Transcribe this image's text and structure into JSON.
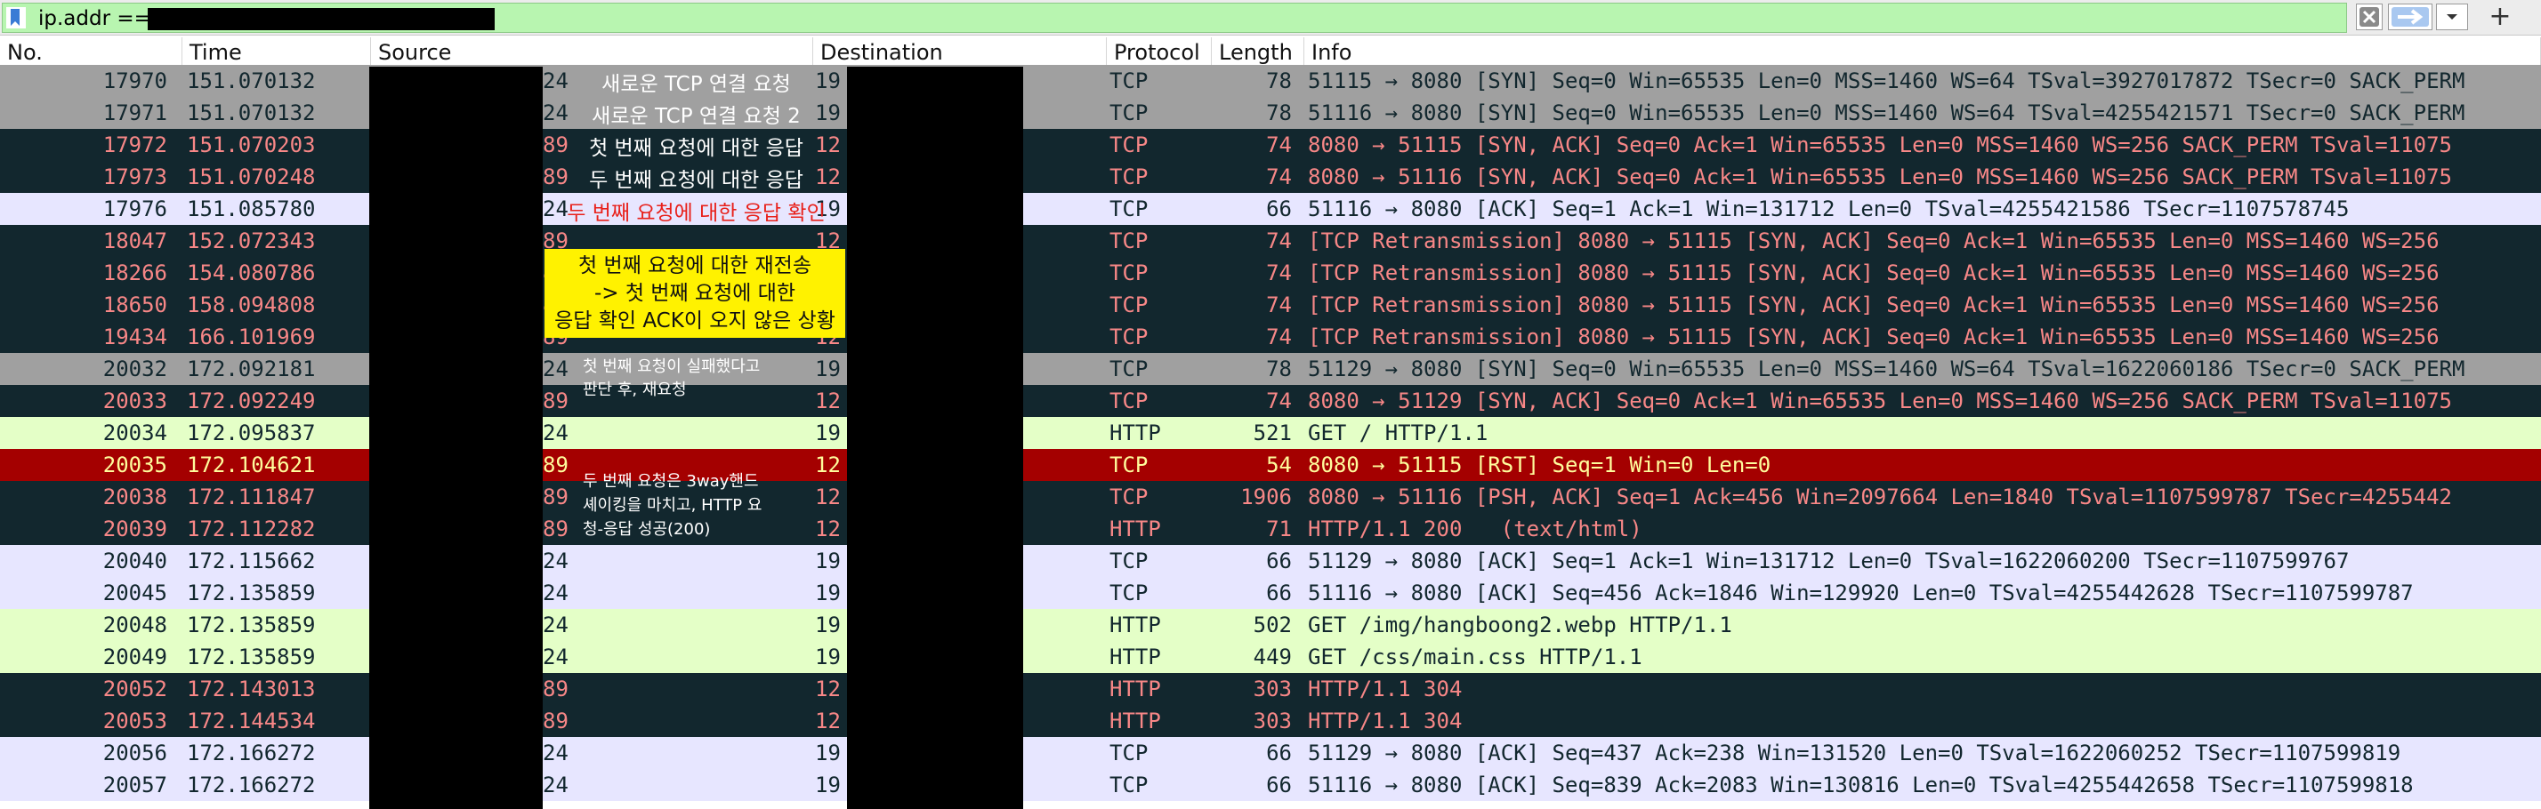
{
  "filter": {
    "value": "ip.addr ==",
    "add_label": "+"
  },
  "columns": [
    "No.",
    "Time",
    "Source",
    "Destination",
    "Protocol",
    "Length",
    "Info"
  ],
  "colors": {
    "gray_bg": "#a0a0a0",
    "gray_fg": "#12272e",
    "dark_bg": "#12272e",
    "dark_fg": "#f78787",
    "lav_bg": "#e7e6ff",
    "lav_fg": "#12272e",
    "green_bg": "#e4ffc7",
    "green_fg": "#12272e",
    "red_bg": "#a40000",
    "red_fg": "#fffc9c",
    "yellow_note": "#fff200"
  },
  "rows": [
    {
      "no": "17970",
      "time": "151.070132",
      "src": "24",
      "dst": "19",
      "proto": "TCP",
      "len": "78",
      "info": "51115 → 8080 [SYN] Seq=0 Win=65535 Len=0 MSS=1460 WS=64 TSval=3927017872 TSecr=0 SACK_PERM",
      "style": "gray"
    },
    {
      "no": "17971",
      "time": "151.070132",
      "src": "24",
      "dst": "19",
      "proto": "TCP",
      "len": "78",
      "info": "51116 → 8080 [SYN] Seq=0 Win=65535 Len=0 MSS=1460 WS=64 TSval=4255421571 TSecr=0 SACK_PERM",
      "style": "gray"
    },
    {
      "no": "17972",
      "time": "151.070203",
      "src": "89",
      "dst": "12",
      "proto": "TCP",
      "len": "74",
      "info": "8080 → 51115 [SYN, ACK] Seq=0 Ack=1 Win=65535 Len=0 MSS=1460 WS=256 SACK_PERM TSval=11075",
      "style": "dark"
    },
    {
      "no": "17973",
      "time": "151.070248",
      "src": "89",
      "dst": "12",
      "proto": "TCP",
      "len": "74",
      "info": "8080 → 51116 [SYN, ACK] Seq=0 Ack=1 Win=65535 Len=0 MSS=1460 WS=256 SACK_PERM TSval=11075",
      "style": "dark"
    },
    {
      "no": "17976",
      "time": "151.085780",
      "src": "24",
      "dst": "19",
      "proto": "TCP",
      "len": "66",
      "info": "51116 → 8080 [ACK] Seq=1 Ack=1 Win=131712 Len=0 TSval=4255421586 TSecr=1107578745",
      "style": "lav"
    },
    {
      "no": "18047",
      "time": "152.072343",
      "src": "89",
      "dst": "12",
      "proto": "TCP",
      "len": "74",
      "info": "[TCP Retransmission] 8080 → 51115 [SYN, ACK] Seq=0 Ack=1 Win=65535 Len=0 MSS=1460 WS=256",
      "style": "dark"
    },
    {
      "no": "18266",
      "time": "154.080786",
      "src": "89",
      "dst": "12",
      "proto": "TCP",
      "len": "74",
      "info": "[TCP Retransmission] 8080 → 51115 [SYN, ACK] Seq=0 Ack=1 Win=65535 Len=0 MSS=1460 WS=256",
      "style": "dark"
    },
    {
      "no": "18650",
      "time": "158.094808",
      "src": "89",
      "dst": "12",
      "proto": "TCP",
      "len": "74",
      "info": "[TCP Retransmission] 8080 → 51115 [SYN, ACK] Seq=0 Ack=1 Win=65535 Len=0 MSS=1460 WS=256",
      "style": "dark"
    },
    {
      "no": "19434",
      "time": "166.101969",
      "src": "89",
      "dst": "12",
      "proto": "TCP",
      "len": "74",
      "info": "[TCP Retransmission] 8080 → 51115 [SYN, ACK] Seq=0 Ack=1 Win=65535 Len=0 MSS=1460 WS=256",
      "style": "dark"
    },
    {
      "no": "20032",
      "time": "172.092181",
      "src": "24",
      "dst": "19",
      "proto": "TCP",
      "len": "78",
      "info": "51129 → 8080 [SYN] Seq=0 Win=65535 Len=0 MSS=1460 WS=64 TSval=1622060186 TSecr=0 SACK_PERM",
      "style": "gray"
    },
    {
      "no": "20033",
      "time": "172.092249",
      "src": "89",
      "dst": "12",
      "proto": "TCP",
      "len": "74",
      "info": "8080 → 51129 [SYN, ACK] Seq=0 Ack=1 Win=65535 Len=0 MSS=1460 WS=256 SACK_PERM TSval=11075",
      "style": "dark"
    },
    {
      "no": "20034",
      "time": "172.095837",
      "src": "24",
      "dst": "19",
      "proto": "HTTP",
      "len": "521",
      "info": "GET / HTTP/1.1",
      "style": "green"
    },
    {
      "no": "20035",
      "time": "172.104621",
      "src": "89",
      "dst": "12",
      "proto": "TCP",
      "len": "54",
      "info": "8080 → 51115 [RST] Seq=1 Win=0 Len=0",
      "style": "red"
    },
    {
      "no": "20038",
      "time": "172.111847",
      "src": "89",
      "dst": "12",
      "proto": "TCP",
      "len": "1906",
      "info": "8080 → 51116 [PSH, ACK] Seq=1 Ack=456 Win=2097664 Len=1840 TSval=1107599787 TSecr=4255442",
      "style": "dark"
    },
    {
      "no": "20039",
      "time": "172.112282",
      "src": "89",
      "dst": "12",
      "proto": "HTTP",
      "len": "71",
      "info": "HTTP/1.1 200   (text/html)",
      "style": "dark"
    },
    {
      "no": "20040",
      "time": "172.115662",
      "src": "24",
      "dst": "19",
      "proto": "TCP",
      "len": "66",
      "info": "51129 → 8080 [ACK] Seq=1 Ack=1 Win=131712 Len=0 TSval=1622060200 TSecr=1107599767",
      "style": "lav"
    },
    {
      "no": "20045",
      "time": "172.135859",
      "src": "24",
      "dst": "19",
      "proto": "TCP",
      "len": "66",
      "info": "51116 → 8080 [ACK] Seq=456 Ack=1846 Win=129920 Len=0 TSval=4255442628 TSecr=1107599787",
      "style": "lav"
    },
    {
      "no": "20048",
      "time": "172.135859",
      "src": "24",
      "dst": "19",
      "proto": "HTTP",
      "len": "502",
      "info": "GET /img/hangboong2.webp HTTP/1.1",
      "style": "green"
    },
    {
      "no": "20049",
      "time": "172.135859",
      "src": "24",
      "dst": "19",
      "proto": "HTTP",
      "len": "449",
      "info": "GET /css/main.css HTTP/1.1",
      "style": "green"
    },
    {
      "no": "20052",
      "time": "172.143013",
      "src": "89",
      "dst": "12",
      "proto": "HTTP",
      "len": "303",
      "info": "HTTP/1.1 304",
      "style": "dark"
    },
    {
      "no": "20053",
      "time": "172.144534",
      "src": "89",
      "dst": "12",
      "proto": "HTTP",
      "len": "303",
      "info": "HTTP/1.1 304",
      "style": "dark"
    },
    {
      "no": "20056",
      "time": "172.166272",
      "src": "24",
      "dst": "19",
      "proto": "TCP",
      "len": "66",
      "info": "51129 → 8080 [ACK] Seq=437 Ack=238 Win=131520 Len=0 TSval=1622060252 TSecr=1107599819",
      "style": "lav"
    },
    {
      "no": "20057",
      "time": "172.166272",
      "src": "24",
      "dst": "19",
      "proto": "TCP",
      "len": "66",
      "info": "51116 → 8080 [ACK] Seq=839 Ack=2083 Win=130816 Len=0 TSval=4255442658 TSecr=1107599818",
      "style": "lav"
    }
  ],
  "annotations": {
    "a1": "새로운 TCP 연결 요청",
    "a2": "새로운 TCP 연결 요청 2",
    "a3": "첫 번째 요청에 대한 응답",
    "a4": "두 번째 요청에 대한 응답",
    "a5": "두 번째 요청에 대한 응답 확인",
    "a6": "첫 번째 요청에 대한 재전송\n-> 첫 번째 요청에 대한\n응답 확인 ACK이 오지 않은 상황",
    "a7": "첫 번째 요청이 실패했다고\n판단 후, 재요청",
    "a8": "두 번째 요청은 3way핸드\n셰이킹을 마치고, HTTP 요\n청-응답 성공(200)"
  }
}
